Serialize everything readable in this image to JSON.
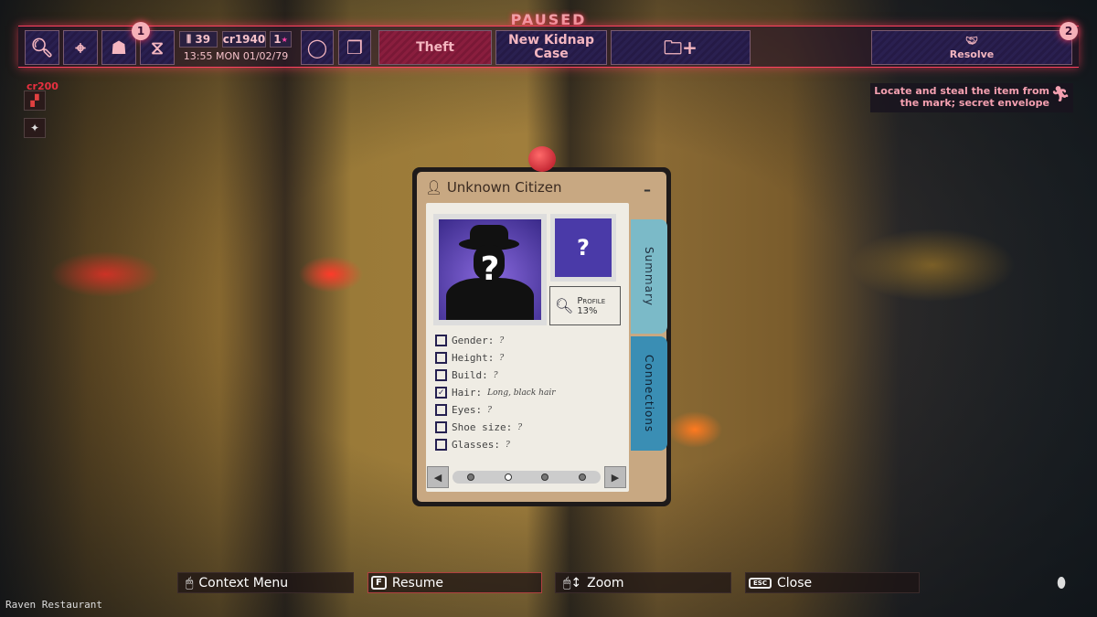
{
  "status": "PAUSED",
  "topbar": {
    "icons": [
      "magnifier-icon",
      "map-pin-icon",
      "spy-hat-icon",
      "dna-icon"
    ],
    "notification_badge_1": "1",
    "notification_badge_2": "2",
    "ammo": "39",
    "money": "cr1940",
    "stars": "1",
    "datetime": "13:55 MON 01/02/79",
    "tabs": {
      "theft": "Theft",
      "kidnap": "New Kidnap Case",
      "resolve": "Resolve"
    }
  },
  "side": {
    "cost": "cr200"
  },
  "objective": "Locate and steal the item from the mark; secret envelope",
  "card": {
    "title": "Unknown Citizen",
    "minimize": "–",
    "portrait_mark": "?",
    "fingerprint_mark": "?",
    "profile_label": "Profile",
    "profile_percent": "13%",
    "tabs": {
      "summary": "Summary",
      "connections": "Connections"
    },
    "attributes": [
      {
        "label": "Gender:",
        "value": "?",
        "checked": false
      },
      {
        "label": "Height:",
        "value": "?",
        "checked": false
      },
      {
        "label": "Build:",
        "value": "?",
        "checked": false
      },
      {
        "label": "Hair:",
        "value": "Long, black hair",
        "checked": true
      },
      {
        "label": "Eyes:",
        "value": "?",
        "checked": false
      },
      {
        "label": "Shoe size:",
        "value": "?",
        "checked": false
      },
      {
        "label": "Glasses:",
        "value": "?",
        "checked": false
      }
    ],
    "page": 2,
    "pages": 4
  },
  "hints": {
    "context": "Context Menu",
    "resume_key": "F",
    "resume": "Resume",
    "zoom": "Zoom",
    "close_key": "ESC",
    "close": "Close"
  },
  "location": "Raven Restaurant",
  "colors": {
    "accent": "#ff4060",
    "text_pink": "#f4b6c0",
    "theft_tab": "#8a1e3e"
  }
}
